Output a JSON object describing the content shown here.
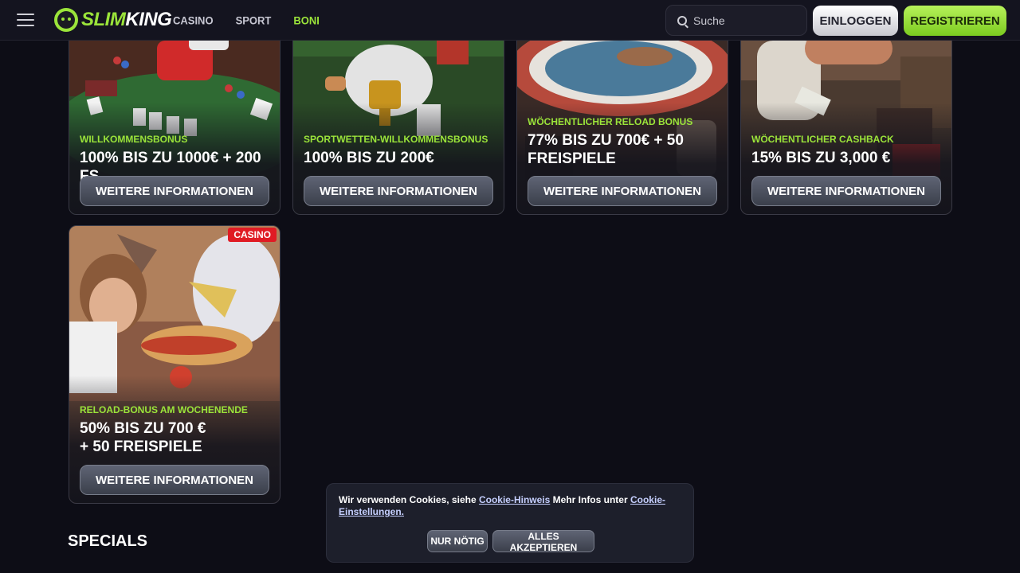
{
  "header": {
    "logo_text_a": "SLIM",
    "logo_text_b": "KING",
    "nav": [
      "CASINO",
      "SPORT",
      "BONI"
    ],
    "search_placeholder": "Suche",
    "login_label": "EINLOGGEN",
    "register_label": "REGISTRIEREN",
    "accent_color": "#9be43a"
  },
  "cards": [
    {
      "label": "WILLKOMMENSBONUS",
      "title": "100% BIS ZU 1000€ + 200 FS",
      "button": "WEITERE INFORMATIONEN"
    },
    {
      "label": "SPORTWETTEN-WILLKOMMENSBONUS",
      "title": "100% BIS ZU 200€",
      "button": "WEITERE INFORMATIONEN"
    },
    {
      "label": "WÖCHENTLICHER RELOAD BONUS",
      "title": "77% BIS ZU 700€ + 50 FREISPIELE",
      "button": "WEITERE INFORMATIONEN"
    },
    {
      "label": "WÖCHENTLICHER CASHBACK",
      "title": "15% BIS ZU 3,000 €",
      "button": "WEITERE INFORMATIONEN"
    },
    {
      "badge": "CASINO",
      "label": "RELOAD-BONUS AM WOCHENENDE",
      "title": "50% BIS ZU 700 € + 50 FREISPIELE",
      "button": "WEITERE INFORMATIONEN"
    }
  ],
  "section_title": "SPECIALS",
  "cookie": {
    "text_a": "Wir verwenden Cookies, siehe ",
    "link_a": "Cookie-Hinweis",
    "text_b": " Mehr Infos unter ",
    "link_b": "Cookie-Einstellungen.",
    "btn_necessary": "NUR NÖTIG",
    "btn_accept": "ALLES AKZEPTIEREN"
  }
}
